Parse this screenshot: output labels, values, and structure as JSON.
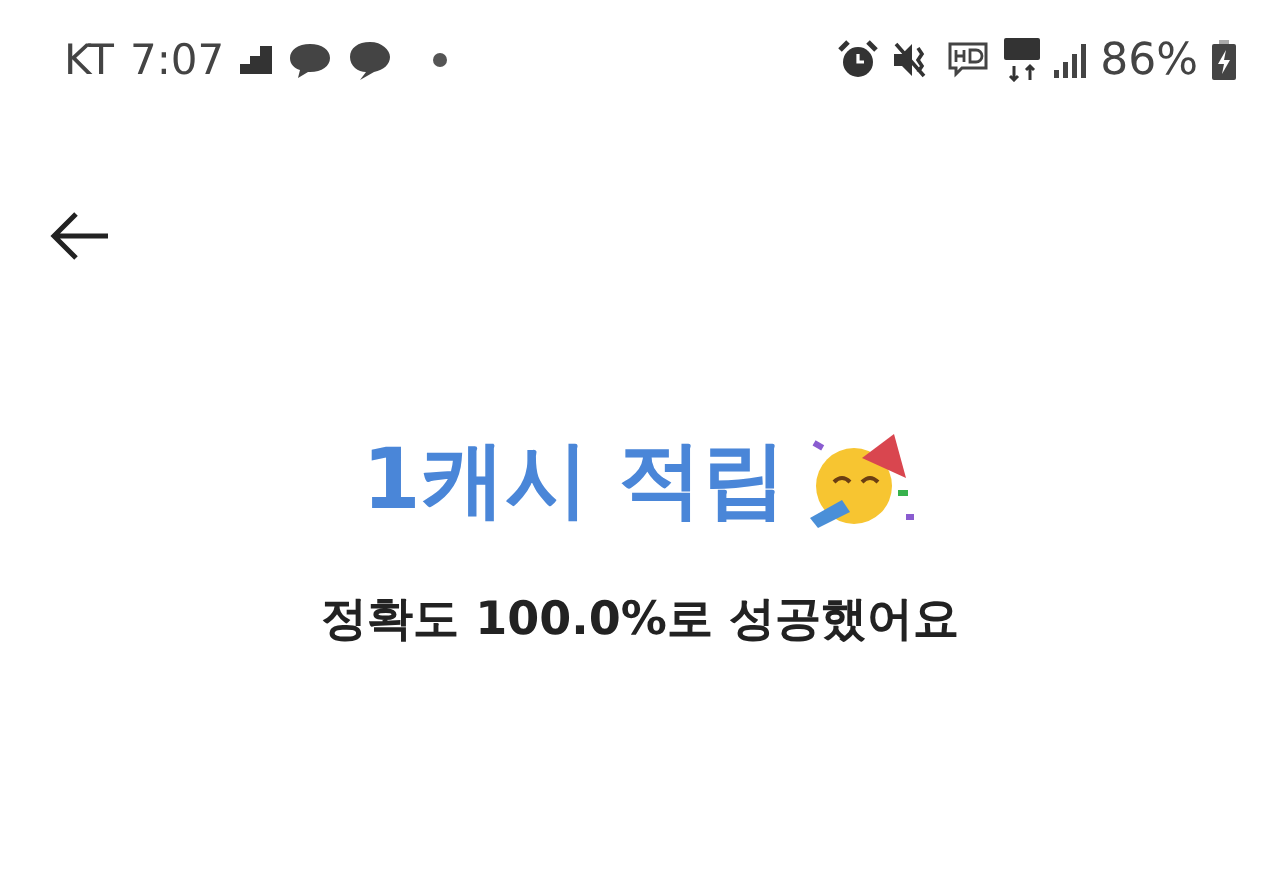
{
  "status_bar": {
    "carrier": "KT",
    "time": "7:07",
    "battery": "86%"
  },
  "result": {
    "title": "1캐시 적립",
    "message": "정확도 100.0%로 성공했어요"
  }
}
